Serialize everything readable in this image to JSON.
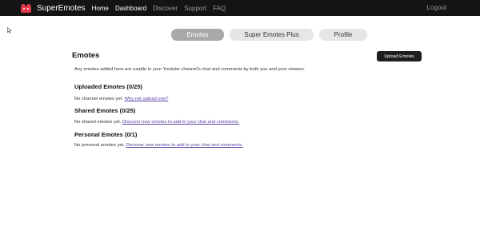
{
  "navbar": {
    "brand": "SuperEmotes",
    "links": [
      "Home",
      "Dashboard",
      "Discover",
      "Support",
      "FAQ"
    ],
    "logout": "Logout",
    "colors": {
      "background": "#141414",
      "logo": "#e0394a"
    }
  },
  "tabs": {
    "emotes": "Emotes",
    "super_emotes_plus": "Super Emotes Plus",
    "profile": "Profile"
  },
  "main": {
    "title": "Emotes",
    "upload_button": "Upload Emotes",
    "description": "Any emotes added here are usable in your Youtube channel's chat and comments by both you and your viewers."
  },
  "sections": {
    "uploaded": {
      "heading": "Uploaded Emotes (0/25)",
      "text": "No channel emotes yet.",
      "link": "Why not upload one?"
    },
    "shared": {
      "heading": "Shared Emotes (0/25)",
      "text": "No shared emotes yet.",
      "link": "Discover new emotes to add to your chat and comments."
    },
    "personal": {
      "heading": "Personal Emotes (0/1)",
      "text": "No personal emotes yet.",
      "link": "Discover new emotes to add to your chat and comments."
    }
  }
}
